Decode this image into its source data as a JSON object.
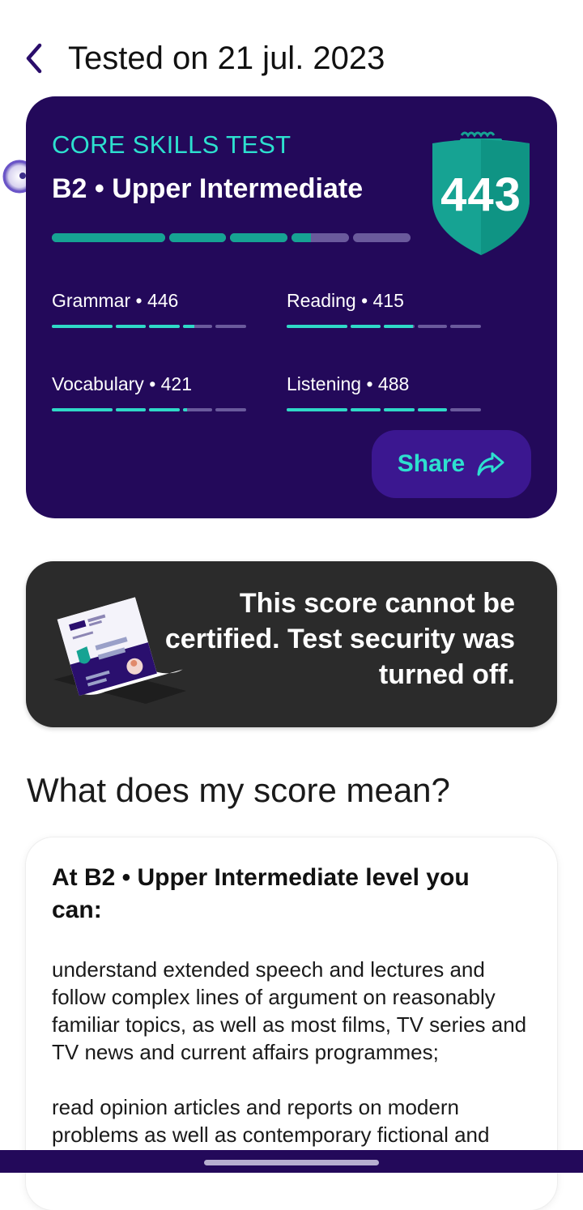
{
  "header": {
    "title": "Tested on 21 jul. 2023",
    "back_icon": "chevron-left-icon"
  },
  "score_card": {
    "test_label": "CORE SKILLS TEST",
    "level": "B2 • Upper Intermediate",
    "overall_score": "443",
    "overall_progress": 0.72,
    "skills": [
      {
        "label": "Grammar • 446",
        "progress": 0.73
      },
      {
        "label": "Reading • 415",
        "progress": 0.66
      },
      {
        "label": "Vocabulary • 421",
        "progress": 0.69
      },
      {
        "label": "Listening • 488",
        "progress": 0.83
      }
    ],
    "share_label": "Share",
    "share_icon": "share-arrow-icon",
    "colors": {
      "card_bg": "#23095a",
      "accent": "#2de0cf",
      "shield": "#16a393"
    }
  },
  "notice": {
    "text": "This score cannot be certified. Test security was turned off.",
    "illustration": "certificate-illustration"
  },
  "meaning": {
    "section_title": "What does my score mean?",
    "card_heading": "At B2 • Upper Intermediate level you can:",
    "paragraphs": [
      "understand extended speech and lectures and follow complex lines of argument on reasonably familiar topics, as well as most films, TV series and TV news and current affairs programmes;",
      "read opinion articles and reports on modern problems as well as contemporary fictional and"
    ]
  }
}
